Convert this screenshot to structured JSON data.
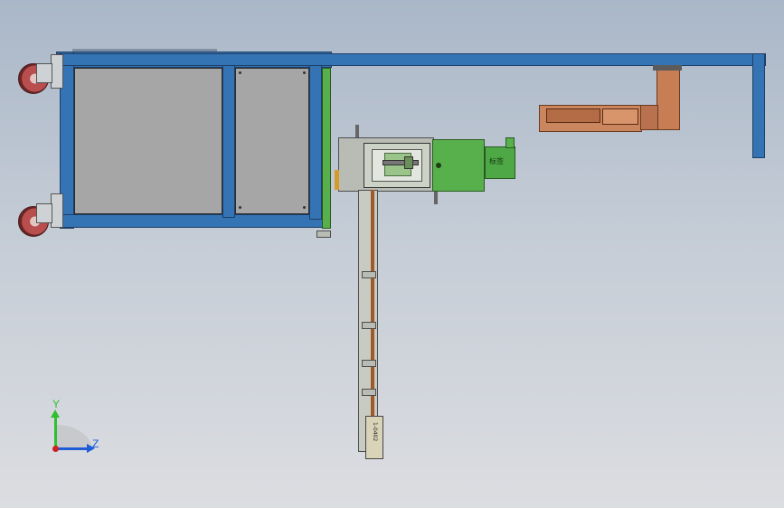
{
  "colors": {
    "frame": "#3574b4",
    "panel": "#a6a6a6",
    "module": "#58b04c",
    "motor_arm": "#c77e55",
    "rail": "#b9bcb4",
    "axis_y": "#2fbf2f",
    "axis_z": "#1f5bd6",
    "axis_origin": "#cc2222"
  },
  "module_tag": "标签",
  "rail_plate_text": "1-0402",
  "triad": {
    "y_label": "Y",
    "z_label": "Z"
  }
}
